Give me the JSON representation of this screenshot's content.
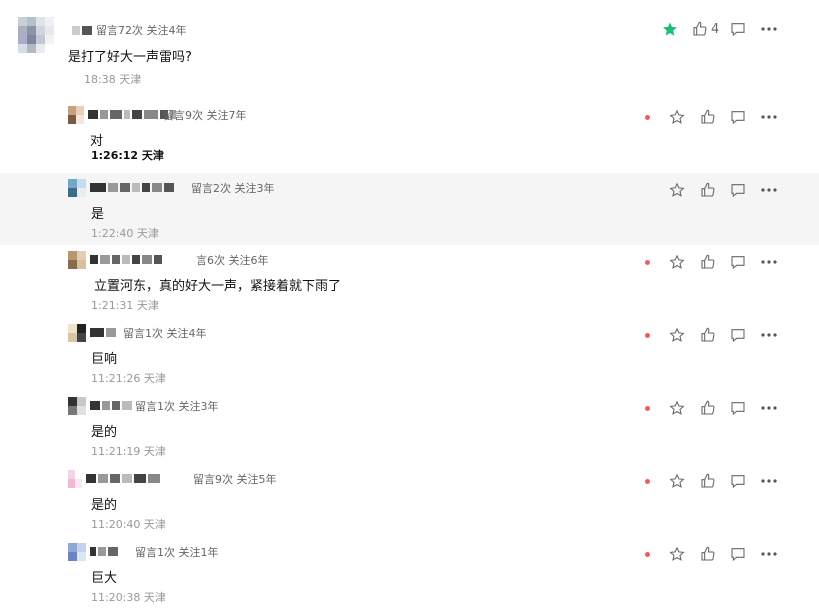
{
  "colors": {
    "accent_star": "#1fbf7a",
    "unread_dot": "#f05b5b",
    "highlight_bg": "#f5f5f5"
  },
  "icons": [
    "star-icon",
    "thumbs-up-icon",
    "comment-icon",
    "more-icon",
    "unread-dot"
  ],
  "comments": [
    {
      "meta": "留言72次 关注4年",
      "text": "是打了好大一声雷吗?",
      "time": "18:38 天津",
      "likes": "4",
      "starred": true
    },
    {
      "meta": "留言9次 关注7年",
      "text": "对",
      "time": "1:26:12 天津"
    },
    {
      "meta": "留言2次 关注3年",
      "text": "是",
      "time": "1:22:40 天津"
    },
    {
      "meta": "言6次 关注6年",
      "text": "立置河东，真的好大一声，紧接着就下雨了",
      "time": "1:21:31 天津"
    },
    {
      "meta": "留言1次 关注4年",
      "text": "巨响",
      "time": "11:21:26 天津"
    },
    {
      "meta": "留言1次 关注3年",
      "text": "是的",
      "time": "11:21:19 天津"
    },
    {
      "meta": "留言9次 关注5年",
      "text": "是的",
      "time": "11:20:40 天津"
    },
    {
      "meta": "留言1次 关注1年",
      "text": "巨大",
      "time": "11:20:38 天津"
    }
  ]
}
